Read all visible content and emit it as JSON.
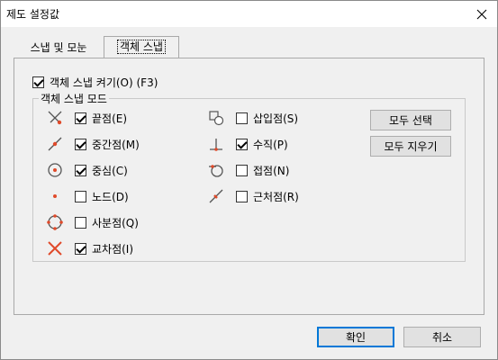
{
  "window": {
    "title": "제도 설정값"
  },
  "tabs": [
    {
      "label": "스냅 및 모눈"
    },
    {
      "label": "객체 스냅"
    }
  ],
  "osnap": {
    "enable_label": "객체 스냅 켜기(O) (F3)",
    "enable_checked": true,
    "group_label": "객체 스냅 모드",
    "modes_left": [
      {
        "label": "끝점(E)",
        "checked": true,
        "icon": "endpoint-icon"
      },
      {
        "label": "중간점(M)",
        "checked": true,
        "icon": "midpoint-icon"
      },
      {
        "label": "중심(C)",
        "checked": true,
        "icon": "center-icon"
      },
      {
        "label": "노드(D)",
        "checked": false,
        "icon": "node-icon"
      },
      {
        "label": "사분점(Q)",
        "checked": false,
        "icon": "quadrant-icon"
      },
      {
        "label": "교차점(I)",
        "checked": true,
        "icon": "intersection-icon"
      }
    ],
    "modes_right": [
      {
        "label": "삽입점(S)",
        "checked": false,
        "icon": "insertion-icon"
      },
      {
        "label": "수직(P)",
        "checked": true,
        "icon": "perpendicular-icon"
      },
      {
        "label": "접점(N)",
        "checked": false,
        "icon": "tangent-icon"
      },
      {
        "label": "근처점(R)",
        "checked": false,
        "icon": "nearest-icon"
      }
    ],
    "select_all_label": "모두 선택",
    "clear_all_label": "모두 지우기"
  },
  "footer": {
    "ok_label": "확인",
    "cancel_label": "취소"
  },
  "colors": {
    "snap_marker": "#e04a2a",
    "accent_border": "#0078d7"
  }
}
